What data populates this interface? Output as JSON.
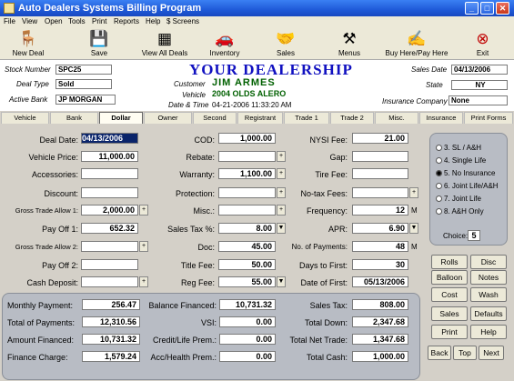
{
  "window": {
    "title": "Auto Dealers Systems Billing Program",
    "minimize": "_",
    "maximize": "□",
    "close": "✕"
  },
  "menu": [
    "File",
    "View",
    "Open",
    "Tools",
    "Print",
    "Reports",
    "Help",
    "$ Screens"
  ],
  "toolbar": [
    {
      "label": "New Deal",
      "icon": "chair-icon"
    },
    {
      "label": "Save",
      "icon": "floppy-disk-icon"
    },
    {
      "label": "View All Deals",
      "icon": "cars-icon"
    },
    {
      "label": "Inventory",
      "icon": "car-icon"
    },
    {
      "label": "Sales",
      "icon": "handshake-icon"
    },
    {
      "label": "Menus",
      "icon": "tools-icon"
    },
    {
      "label": "Buy Here/Pay Here",
      "icon": "pay-icon"
    },
    {
      "label": "Exit",
      "icon": "exit-icon"
    }
  ],
  "header": {
    "dealership": "YOUR DEALERSHIP",
    "stock_number_label": "Stock Number",
    "stock_number": "SPC25",
    "deal_type_label": "Deal Type",
    "deal_type": "Sold",
    "active_bank_label": "Active Bank",
    "active_bank": "JP MORGAN",
    "customer_label": "Customer",
    "customer": "JIM ARMES",
    "vehicle_label": "Vehicle",
    "vehicle": "2004 OLDS ALERO",
    "date_time_label": "Date & Time",
    "date_time": "04-21-2006  11:33:20 AM",
    "sales_date_label": "Sales Date",
    "sales_date": "04/13/2006",
    "state_label": "State",
    "state": "NY",
    "insurance_label": "Insurance Company",
    "insurance": "None"
  },
  "tabs": [
    "Vehicle",
    "Bank",
    "Dollar",
    "Owner",
    "Second",
    "Registrant",
    "Trade 1",
    "Trade 2",
    "Misc.",
    "Insurance",
    "Print Forms"
  ],
  "active_tab": "Dollar",
  "col1": [
    {
      "label": "Deal Date:",
      "value": "04/13/2006"
    },
    {
      "label": "Vehicle Price:",
      "value": "11,000.00"
    },
    {
      "label": "Accessories:",
      "value": ""
    },
    {
      "label": "Discount:",
      "value": ""
    },
    {
      "label": "Gross Trade Allow 1:",
      "value": "2,000.00"
    },
    {
      "label": "Pay Off 1:",
      "value": "652.32"
    },
    {
      "label": "Gross Trade Allow 2:",
      "value": ""
    },
    {
      "label": "Pay Off 2:",
      "value": ""
    },
    {
      "label": "Cash Deposit:",
      "value": ""
    }
  ],
  "col2": [
    {
      "label": "COD:",
      "value": "1,000.00"
    },
    {
      "label": "Rebate:",
      "value": ""
    },
    {
      "label": "Warranty:",
      "value": "1,100.00"
    },
    {
      "label": "Protection:",
      "value": ""
    },
    {
      "label": "Misc.:",
      "value": ""
    },
    {
      "label": "Sales Tax %:",
      "value": "8.00"
    },
    {
      "label": "Doc:",
      "value": "45.00"
    },
    {
      "label": "Title Fee:",
      "value": "50.00"
    },
    {
      "label": "Reg Fee:",
      "value": "55.00"
    }
  ],
  "col3": [
    {
      "label": "NYSI Fee:",
      "value": "21.00"
    },
    {
      "label": "Gap:",
      "value": ""
    },
    {
      "label": "Tire Fee:",
      "value": ""
    },
    {
      "label": "No-tax Fees:",
      "value": ""
    },
    {
      "label": "Frequency:",
      "value": "12",
      "suffix": "M"
    },
    {
      "label": "APR:",
      "value": "6.90"
    },
    {
      "label": "No. of Payments:",
      "value": "48",
      "suffix": "M"
    },
    {
      "label": "Days to First:",
      "value": "30"
    },
    {
      "label": "Date of First:",
      "value": "05/13/2006"
    }
  ],
  "insurance_options": [
    "3. SL / A&H",
    "4. Single Life",
    "5. No Insurance",
    "6. Joint Life/A&H",
    "7. Joint Life",
    "8. A&H Only"
  ],
  "insurance_selected": 2,
  "choice_label": "Choice:",
  "choice": "5",
  "side_buttons": [
    [
      "Rolls",
      "Disc"
    ],
    [
      "Balloon",
      "Notes"
    ],
    [
      "Cost",
      "Wash"
    ],
    [
      "Sales",
      "Defaults"
    ],
    [
      "Print",
      "Help"
    ]
  ],
  "nav_buttons": [
    "Back",
    "Top",
    "Next"
  ],
  "summary": [
    {
      "label": "Monthly Payment:",
      "value": "256.47"
    },
    {
      "label": "Total of Payments:",
      "value": "12,310.56"
    },
    {
      "label": "Amount Financed:",
      "value": "10,731.32"
    },
    {
      "label": "Finance Charge:",
      "value": "1,579.24"
    },
    {
      "label": "Balance Financed:",
      "value": "10,731.32"
    },
    {
      "label": "VSI:",
      "value": "0.00"
    },
    {
      "label": "Credit/Life Prem.:",
      "value": "0.00"
    },
    {
      "label": "Acc/Health Prem.:",
      "value": "0.00"
    },
    {
      "label": "Sales Tax:",
      "value": "808.00"
    },
    {
      "label": "Total Down:",
      "value": "2,347.68"
    },
    {
      "label": "Total Net Trade:",
      "value": "1,347.68"
    },
    {
      "label": "Total Cash:",
      "value": "1,000.00"
    }
  ]
}
